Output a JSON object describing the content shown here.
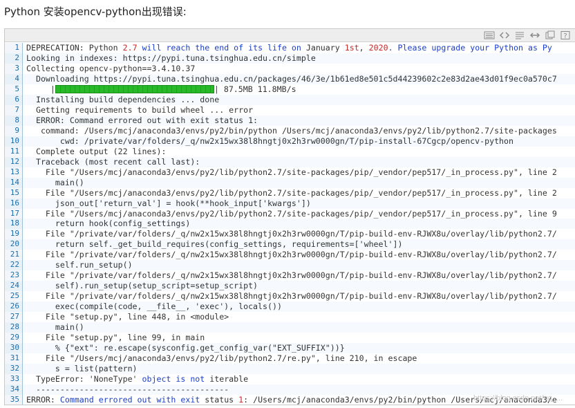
{
  "page": {
    "heading": "Python 安装opencv-python出现错误:",
    "watermark": "https://blog.csdn.net/qq_..."
  },
  "toolbar": {
    "icons": [
      "view-source-icon",
      "code-icon",
      "copy-icon",
      "expand-icon",
      "print-icon",
      "help-icon"
    ]
  },
  "colors": {
    "gutter_text": "#1b6ca8",
    "keyword": "#1a3ec9",
    "number": "#c62828",
    "progress": "#28b928"
  },
  "code": {
    "lines": [
      {
        "n": "1",
        "segments": [
          {
            "t": "DEPRECATION: Python ",
            "c": ""
          },
          {
            "t": "2.7",
            "c": "num"
          },
          {
            "t": " will reach the end of its life on",
            "c": "kw"
          },
          {
            "t": " January ",
            "c": ""
          },
          {
            "t": "1st",
            "c": "num"
          },
          {
            "t": ", ",
            "c": ""
          },
          {
            "t": "2020",
            "c": "num"
          },
          {
            "t": ". Please upgrade your Python as Py",
            "c": "kw"
          }
        ]
      },
      {
        "n": "2",
        "segments": [
          {
            "t": "Looking in indexes: https://pypi.tuna.tsinghua.edu.cn/simple",
            "c": ""
          }
        ]
      },
      {
        "n": "3",
        "segments": [
          {
            "t": "Collecting opencv-python==3.4.10.37",
            "c": ""
          }
        ]
      },
      {
        "n": "4",
        "segments": [
          {
            "t": "  Downloading https://pypi.tuna.tsinghua.edu.cn/packages/46/3e/1b61ed8e501c5d44239602c2e83d2ae43d01f9ec0a570c7",
            "c": ""
          }
        ]
      },
      {
        "n": "5",
        "progress": true,
        "pre": "     |",
        "post": "| 87.5MB 11.8MB/s"
      },
      {
        "n": "6",
        "segments": [
          {
            "t": "  Installing build dependencies ... done",
            "c": ""
          }
        ]
      },
      {
        "n": "7",
        "segments": [
          {
            "t": "  Getting requirements to build wheel ... error",
            "c": ""
          }
        ]
      },
      {
        "n": "8",
        "segments": [
          {
            "t": "  ERROR: Command errored out with exit status 1:",
            "c": ""
          }
        ]
      },
      {
        "n": "9",
        "segments": [
          {
            "t": "   command: /Users/mcj/anaconda3/envs/py2/bin/python /Users/mcj/anaconda3/envs/py2/lib/python2.7/site-packages",
            "c": ""
          }
        ]
      },
      {
        "n": "10",
        "segments": [
          {
            "t": "       cwd: /private/var/folders/_q/nw2x15wx38l8hngtj0x2h3rw0000gn/T/pip-install-67Cgcp/opencv-python",
            "c": ""
          }
        ]
      },
      {
        "n": "11",
        "segments": [
          {
            "t": "  Complete output (22 lines):",
            "c": ""
          }
        ]
      },
      {
        "n": "12",
        "segments": [
          {
            "t": "  Traceback (most recent call last):",
            "c": ""
          }
        ]
      },
      {
        "n": "13",
        "segments": [
          {
            "t": "    File \"/Users/mcj/anaconda3/envs/py2/lib/python2.7/site-packages/pip/_vendor/pep517/_in_process.py\", line 2",
            "c": ""
          }
        ]
      },
      {
        "n": "14",
        "segments": [
          {
            "t": "      main()",
            "c": ""
          }
        ]
      },
      {
        "n": "15",
        "segments": [
          {
            "t": "    File \"/Users/mcj/anaconda3/envs/py2/lib/python2.7/site-packages/pip/_vendor/pep517/_in_process.py\", line 2",
            "c": ""
          }
        ]
      },
      {
        "n": "16",
        "segments": [
          {
            "t": "      json_out['return_val'] = hook(**hook_input['kwargs'])",
            "c": ""
          }
        ]
      },
      {
        "n": "17",
        "segments": [
          {
            "t": "    File \"/Users/mcj/anaconda3/envs/py2/lib/python2.7/site-packages/pip/_vendor/pep517/_in_process.py\", line 9",
            "c": ""
          }
        ]
      },
      {
        "n": "18",
        "segments": [
          {
            "t": "      return hook(config_settings)",
            "c": ""
          }
        ]
      },
      {
        "n": "19",
        "segments": [
          {
            "t": "    File \"/private/var/folders/_q/nw2x15wx38l8hngtj0x2h3rw0000gn/T/pip-build-env-RJWX8u/overlay/lib/python2.7/",
            "c": ""
          }
        ]
      },
      {
        "n": "20",
        "segments": [
          {
            "t": "      return self._get_build_requires(config_settings, requirements=['wheel'])",
            "c": ""
          }
        ]
      },
      {
        "n": "21",
        "segments": [
          {
            "t": "    File \"/private/var/folders/_q/nw2x15wx38l8hngtj0x2h3rw0000gn/T/pip-build-env-RJWX8u/overlay/lib/python2.7/",
            "c": ""
          }
        ]
      },
      {
        "n": "22",
        "segments": [
          {
            "t": "      self.run_setup()",
            "c": ""
          }
        ]
      },
      {
        "n": "23",
        "segments": [
          {
            "t": "    File \"/private/var/folders/_q/nw2x15wx38l8hngtj0x2h3rw0000gn/T/pip-build-env-RJWX8u/overlay/lib/python2.7/",
            "c": ""
          }
        ]
      },
      {
        "n": "24",
        "segments": [
          {
            "t": "      self).run_setup(setup_script=setup_script)",
            "c": ""
          }
        ]
      },
      {
        "n": "25",
        "segments": [
          {
            "t": "    File \"/private/var/folders/_q/nw2x15wx38l8hngtj0x2h3rw0000gn/T/pip-build-env-RJWX8u/overlay/lib/python2.7/",
            "c": ""
          }
        ]
      },
      {
        "n": "26",
        "segments": [
          {
            "t": "      exec(compile(code, __file__, 'exec'), locals())",
            "c": ""
          }
        ]
      },
      {
        "n": "27",
        "segments": [
          {
            "t": "    File \"setup.py\", line 448, in <module>",
            "c": ""
          }
        ]
      },
      {
        "n": "28",
        "segments": [
          {
            "t": "      main()",
            "c": ""
          }
        ]
      },
      {
        "n": "29",
        "segments": [
          {
            "t": "    File \"setup.py\", line 99, in main",
            "c": ""
          }
        ]
      },
      {
        "n": "30",
        "segments": [
          {
            "t": "      % {\"ext\": re.escape(sysconfig.get_config_var(\"EXT_SUFFIX\"))}",
            "c": ""
          }
        ]
      },
      {
        "n": "31",
        "segments": [
          {
            "t": "    File \"/Users/mcj/anaconda3/envs/py2/lib/python2.7/re.py\", line 210, in escape",
            "c": ""
          }
        ]
      },
      {
        "n": "32",
        "segments": [
          {
            "t": "      s = list(pattern)",
            "c": ""
          }
        ]
      },
      {
        "n": "33",
        "segments": [
          {
            "t": "  TypeError: 'NoneType' ",
            "c": ""
          },
          {
            "t": "object is not",
            "c": "kw"
          },
          {
            "t": " iterable",
            "c": ""
          }
        ]
      },
      {
        "n": "34",
        "segments": [
          {
            "t": "  ----------------------------------------",
            "c": ""
          }
        ]
      },
      {
        "n": "35",
        "segments": [
          {
            "t": "ERROR: ",
            "c": ""
          },
          {
            "t": "Command errored out with exit",
            "c": "kw"
          },
          {
            "t": " status ",
            "c": ""
          },
          {
            "t": "1",
            "c": "num"
          },
          {
            "t": ": /Users/mcj/anaconda3/envs/py2/bin/python /Users/mcj/anaconda3/e",
            "c": ""
          }
        ]
      }
    ]
  }
}
